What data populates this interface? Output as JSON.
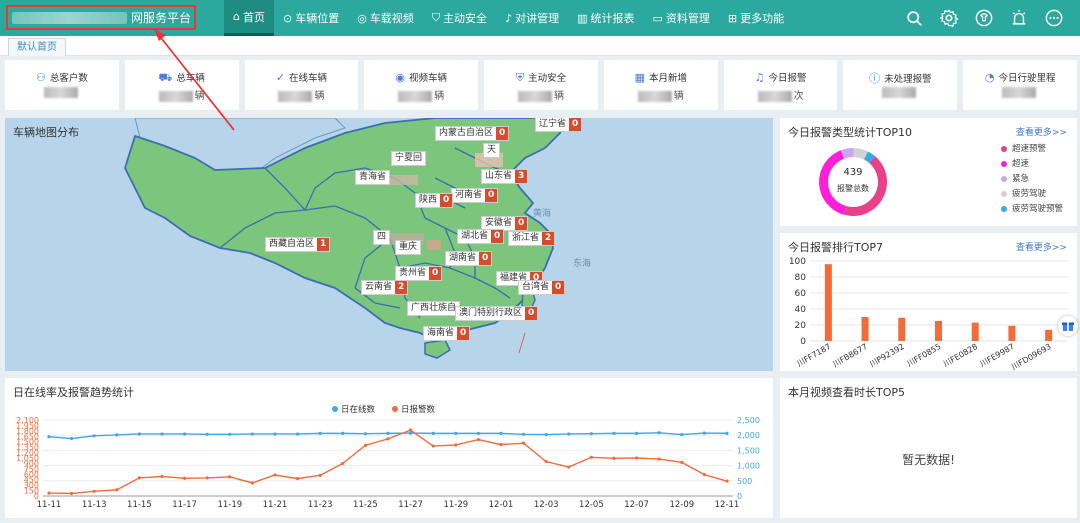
{
  "brand": {
    "title": "网服务平台"
  },
  "nav": [
    {
      "label": "首页",
      "icon": "home-icon"
    },
    {
      "label": "车辆位置",
      "icon": "location-icon"
    },
    {
      "label": "车载视频",
      "icon": "camera-icon"
    },
    {
      "label": "主动安全",
      "icon": "shield-icon"
    },
    {
      "label": "对讲管理",
      "icon": "microphone-icon"
    },
    {
      "label": "统计报表",
      "icon": "bar-chart-icon"
    },
    {
      "label": "资料管理",
      "icon": "monitor-icon"
    },
    {
      "label": "更多功能",
      "icon": "grid-icon"
    }
  ],
  "tools": [
    "search-icon",
    "gear-icon",
    "shirt-icon",
    "alarm-icon",
    "more-icon"
  ],
  "tabs": [
    {
      "label": "默认首页"
    }
  ],
  "stats": [
    {
      "label": "总客户数",
      "icon": "user-icon",
      "unit": ""
    },
    {
      "label": "总车辆",
      "icon": "car-icon",
      "unit": "辆"
    },
    {
      "label": "在线车辆",
      "icon": "check-circle-icon",
      "unit": "辆"
    },
    {
      "label": "视频车辆",
      "icon": "video-icon",
      "unit": "辆"
    },
    {
      "label": "主动安全",
      "icon": "shield-plus-icon",
      "unit": "辆"
    },
    {
      "label": "本月新增",
      "icon": "calendar-plus-icon",
      "unit": "辆"
    },
    {
      "label": "今日报警",
      "icon": "bell-icon",
      "unit": "次"
    },
    {
      "label": "未处理报警",
      "icon": "info-icon",
      "unit": ""
    },
    {
      "label": "今日行驶里程",
      "icon": "speedometer-icon",
      "unit": ""
    }
  ],
  "map": {
    "title": "车辆地图分布",
    "provinces": [
      {
        "name": "辽宁省",
        "count": "0"
      },
      {
        "name": "内蒙古自治区",
        "count": "0"
      },
      {
        "name": "宁夏回",
        "count": ""
      },
      {
        "name": "天",
        "count": ""
      },
      {
        "name": "青海省",
        "count": ""
      },
      {
        "name": "山东省",
        "count": "3"
      },
      {
        "name": "河南省",
        "count": "0"
      },
      {
        "name": "陕西",
        "count": "0"
      },
      {
        "name": "安徽省",
        "count": "0"
      },
      {
        "name": "西藏自治区",
        "count": "1"
      },
      {
        "name": "湖北省",
        "count": "0"
      },
      {
        "name": "浙江省",
        "count": "2"
      },
      {
        "name": "重庆",
        "count": ""
      },
      {
        "name": "四",
        "count": ""
      },
      {
        "name": "湖南省",
        "count": "0"
      },
      {
        "name": "贵州省",
        "count": "0"
      },
      {
        "name": "福建省",
        "count": "0"
      },
      {
        "name": "台湾省",
        "count": "0"
      },
      {
        "name": "云南省",
        "count": "2"
      },
      {
        "name": "广西壮族自",
        "count": ""
      },
      {
        "name": "澳门特别行政区",
        "count": "0"
      },
      {
        "name": "海南省",
        "count": "0"
      }
    ],
    "seas": [
      "黄海",
      "东海"
    ]
  },
  "alarm_types": {
    "title": "今日报警类型统计TOP10",
    "more": "查看更多>>",
    "total": "439",
    "total_label": "报警总数",
    "legend": [
      {
        "name": "超速预警",
        "color": "#e8418a"
      },
      {
        "name": "超速",
        "color": "#ff1fd8"
      },
      {
        "name": "紧急",
        "color": "#c9a4f0"
      },
      {
        "name": "疲劳驾驶",
        "color": "#d2d2d2"
      },
      {
        "name": "疲劳驾驶预警",
        "color": "#36a9e8"
      }
    ],
    "chart_data": {
      "type": "pie",
      "labels": [
        "超速预警",
        "超速",
        "紧急",
        "疲劳驾驶",
        "疲劳驾驶预警"
      ],
      "values": [
        0.43,
        0.4,
        0.06,
        0.07,
        0.04
      ]
    }
  },
  "alarm_rank": {
    "title": "今日报警排行TOP7",
    "more": "查看更多>>",
    "chart_data": {
      "type": "bar",
      "categories": [
        "川FF7187",
        "川FB8677",
        "川P92392",
        "川FF0855",
        "川FE0828",
        "川FE9987",
        "川FD09693"
      ],
      "values": [
        96,
        30,
        29,
        25,
        23,
        19,
        14
      ],
      "ylim": [
        0,
        100
      ],
      "yticks": [
        0,
        20,
        40,
        60,
        80,
        100
      ],
      "color": "#f26b3a"
    }
  },
  "trend": {
    "title": "日在线率及报警趋势统计",
    "chart_data": {
      "type": "line",
      "x": [
        "11-11",
        "11-12",
        "11-13",
        "11-14",
        "11-15",
        "11-16",
        "11-17",
        "11-18",
        "11-19",
        "11-20",
        "11-21",
        "11-22",
        "11-23",
        "11-24",
        "11-25",
        "11-26",
        "11-27",
        "11-28",
        "11-29",
        "11-30",
        "12-01",
        "12-02",
        "12-03",
        "12-04",
        "12-05",
        "12-06",
        "12-07",
        "12-08",
        "12-09",
        "12-10",
        "12-11"
      ],
      "xticks": [
        "11-11",
        "11-13",
        "11-15",
        "11-17",
        "11-19",
        "11-21",
        "11-23",
        "11-25",
        "11-27",
        "11-29",
        "12-01",
        "12-03",
        "12-05",
        "12-07",
        "12-09",
        "12-11"
      ],
      "series": [
        {
          "name": "日在线数",
          "axis": "right",
          "color": "#3fa7e8",
          "values": [
            1950,
            1890,
            1980,
            2010,
            2040,
            2040,
            2040,
            2030,
            2030,
            2040,
            2040,
            2040,
            2060,
            2060,
            2050,
            2060,
            2070,
            2060,
            2060,
            2060,
            2060,
            2030,
            2020,
            2040,
            2050,
            2060,
            2060,
            2080,
            2020,
            2070,
            2060
          ]
        },
        {
          "name": "日报警数",
          "axis": "left",
          "color": "#f26b3a",
          "values": [
            80,
            70,
            130,
            170,
            500,
            540,
            490,
            500,
            530,
            360,
            580,
            480,
            570,
            900,
            1400,
            1580,
            1820,
            1380,
            1410,
            1560,
            1420,
            1460,
            950,
            800,
            1070,
            1040,
            1050,
            1020,
            930,
            590,
            410
          ]
        }
      ],
      "yleft": {
        "ticks": [
          0,
          150,
          300,
          450,
          600,
          750,
          900,
          1050,
          1200,
          1350,
          1500,
          1650,
          1800,
          1950,
          2100
        ],
        "max": 2100
      },
      "yright": {
        "ticks": [
          0,
          500,
          1000,
          1500,
          2000,
          2500
        ],
        "max": 2500
      },
      "left_tick_labels": [
        "0",
        "150",
        "300",
        "450",
        "600",
        "750",
        "900",
        "1,050",
        "1,200",
        "1,350",
        "1,500",
        "1,650",
        "1,800",
        "1,950",
        "2,100"
      ],
      "right_tick_labels": [
        "0",
        "500",
        "1,000",
        "1,500",
        "2,000",
        "2,500"
      ]
    }
  },
  "video_top": {
    "title": "本月视频查看时长TOP5",
    "empty": "暂无数据!"
  }
}
